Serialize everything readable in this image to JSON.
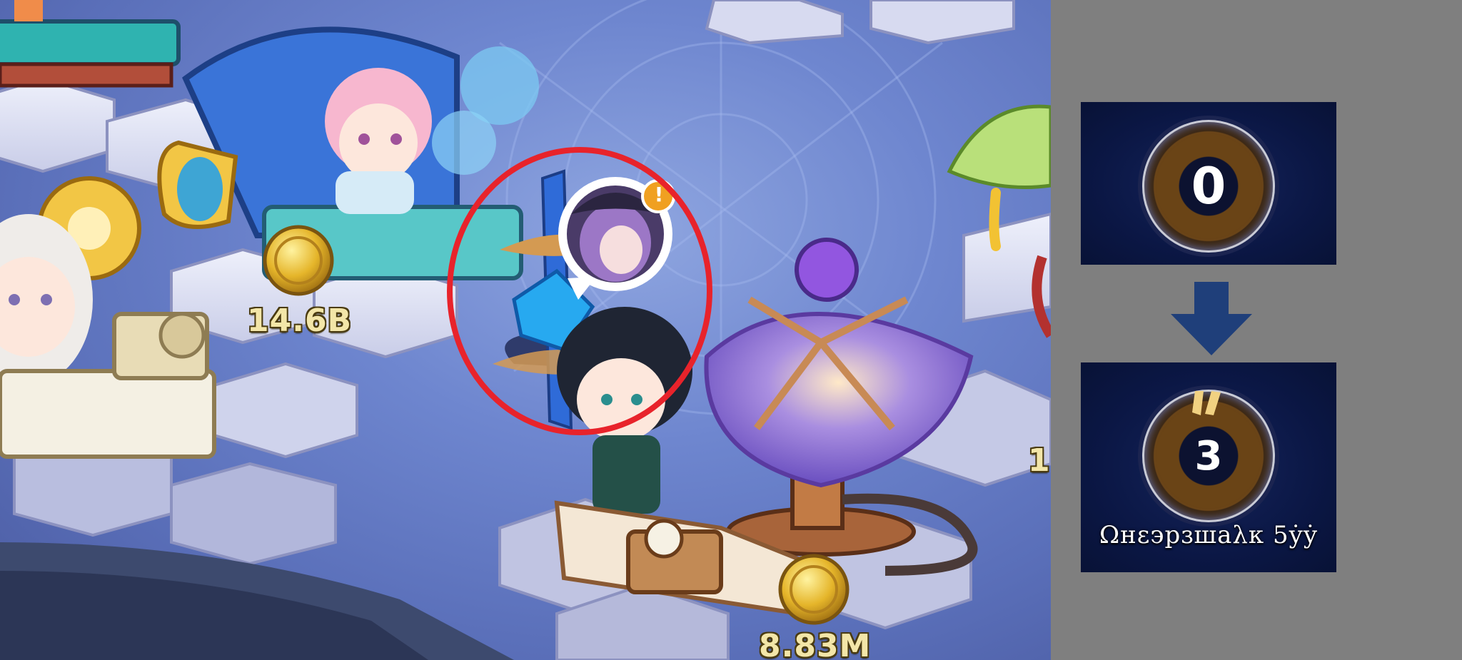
{
  "scene": {
    "currency_labels": [
      {
        "id": "left-station",
        "value": "14.6B"
      },
      {
        "id": "bottom-station",
        "value": "8.83M"
      },
      {
        "id": "right-edge-partial",
        "value": "1"
      }
    ],
    "notification_badge": "!"
  },
  "panel": {
    "before": {
      "count": "0"
    },
    "after": {
      "count": "3",
      "caption": "Ωнɛэpɜшаλк 5ẏẏ"
    }
  },
  "colors": {
    "highlight_circle": "#e8232b",
    "panel_background": "#7f7f7f",
    "arrow": "#1f3f7a",
    "coin": "#e5b52a"
  }
}
